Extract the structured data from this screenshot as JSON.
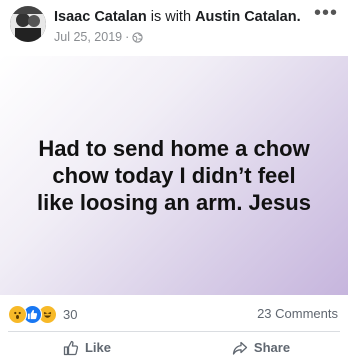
{
  "post": {
    "author": "Isaac Catalan",
    "connector": "is with",
    "tagged": "Austin Catalan.",
    "date": "Jul 25, 2019",
    "separator": "·",
    "privacy_icon": "globe-icon",
    "more_label": "•••"
  },
  "image_text": "Had to send home a chow chow today I didn’t feel like loosing an arm. Jesus",
  "stats": {
    "reaction_icons": [
      "wow-reaction-icon",
      "like-reaction-icon",
      "haha-reaction-icon"
    ],
    "reaction_count": "30",
    "comments": "23 Comments"
  },
  "actions": {
    "like": "Like",
    "share": "Share"
  },
  "colors": {
    "like_blue": "#1877f2",
    "emoji_yellow": "#f7b928",
    "purple_gradient": "#c6b5dd"
  }
}
